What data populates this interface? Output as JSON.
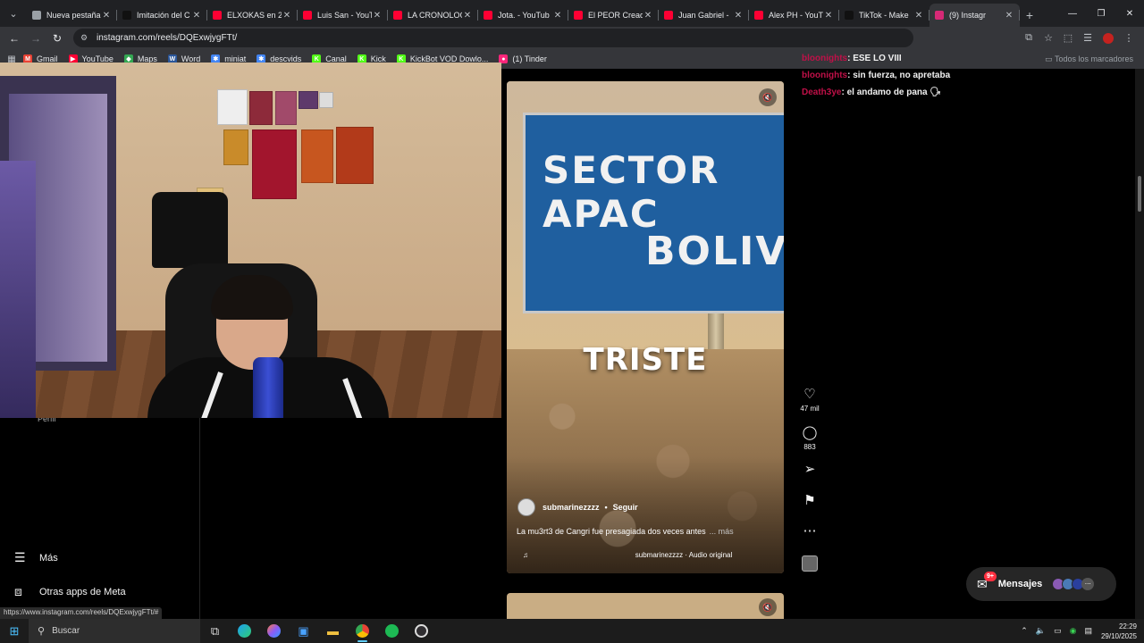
{
  "browser": {
    "tabs": [
      {
        "title": "Nueva pestaña",
        "color": "#9aa0a6",
        "icon": "chrome-icon"
      },
      {
        "title": "Imitación del C",
        "color": "#111111",
        "icon": "tiktok-icon"
      },
      {
        "title": "ELXOKAS en 2(",
        "color": "#ff0033",
        "icon": "youtube-icon"
      },
      {
        "title": "Luis San - YouT",
        "color": "#ff0033",
        "icon": "youtube-icon"
      },
      {
        "title": "LA CRONOLOG",
        "color": "#ff0033",
        "icon": "youtube-icon"
      },
      {
        "title": "Jota. - YouTub",
        "color": "#ff0033",
        "icon": "youtube-icon"
      },
      {
        "title": "El PEOR Cread",
        "color": "#ff0033",
        "icon": "youtube-icon"
      },
      {
        "title": "Juan Gabriel -",
        "color": "#ff0033",
        "icon": "youtube-icon"
      },
      {
        "title": "Alex PH - YouT",
        "color": "#ff0033",
        "icon": "youtube-icon"
      },
      {
        "title": "TikTok - Make",
        "color": "#111111",
        "icon": "tiktok-icon"
      },
      {
        "title": "(9) Instagr",
        "color": "#d62976",
        "icon": "instagram-icon",
        "active": true
      }
    ],
    "url": "instagram.com/reels/DQExwjygFTt/",
    "bookmarks": [
      {
        "label": "Gmail",
        "color": "#ea4335",
        "glyph": "M"
      },
      {
        "label": "YouTube",
        "color": "#ff0033",
        "glyph": "▶"
      },
      {
        "label": "Maps",
        "color": "#34a853",
        "glyph": "◆"
      },
      {
        "label": "Word",
        "color": "#2b579a",
        "glyph": "W"
      },
      {
        "label": "miniat",
        "color": "#4285f4",
        "glyph": "✱"
      },
      {
        "label": "descvids",
        "color": "#4285f4",
        "glyph": "✱"
      },
      {
        "label": "Canal",
        "color": "#53fc18",
        "glyph": "K"
      },
      {
        "label": "Kick",
        "color": "#53fc18",
        "glyph": "K"
      },
      {
        "label": "KickBot VOD Dowlo...",
        "color": "#53fc18",
        "glyph": "K"
      },
      {
        "label": "(1) Tinder",
        "color": "#fd267a",
        "glyph": "●"
      }
    ],
    "all_bookmarks": "Todos los marcadores",
    "status_url": "https://www.instagram.com/reels/DQExwjygFTt/#"
  },
  "left_nav": {
    "partial_item": "Perfil",
    "more": "Más",
    "meta_apps": "Otras apps de Meta"
  },
  "reel": {
    "sign_line1": "SECTOR  APAC",
    "sign_line2": "BOLIVIA",
    "overlay_text": "TRISTE",
    "author": "submarinezzzz",
    "follow": "Seguir",
    "description": "La mu3rt3 de Cangri fue presagiada dos veces antes",
    "more": "... más",
    "audio": "submarinezzzz · Audio original",
    "likes": "47 mil",
    "comments": "883"
  },
  "chat": [
    {
      "user": "bloonights",
      "message": ": ESE LO VIII"
    },
    {
      "user": "bloonights",
      "message": ": sin fuerza, no apretaba"
    },
    {
      "user": "Death3ye",
      "message": ": el andamo de pana 🗣"
    }
  ],
  "messages": {
    "label": "Mensajes",
    "badge": "9+"
  },
  "taskbar": {
    "search_placeholder": "Buscar",
    "time": "22:29",
    "date": "29/10/2025"
  }
}
